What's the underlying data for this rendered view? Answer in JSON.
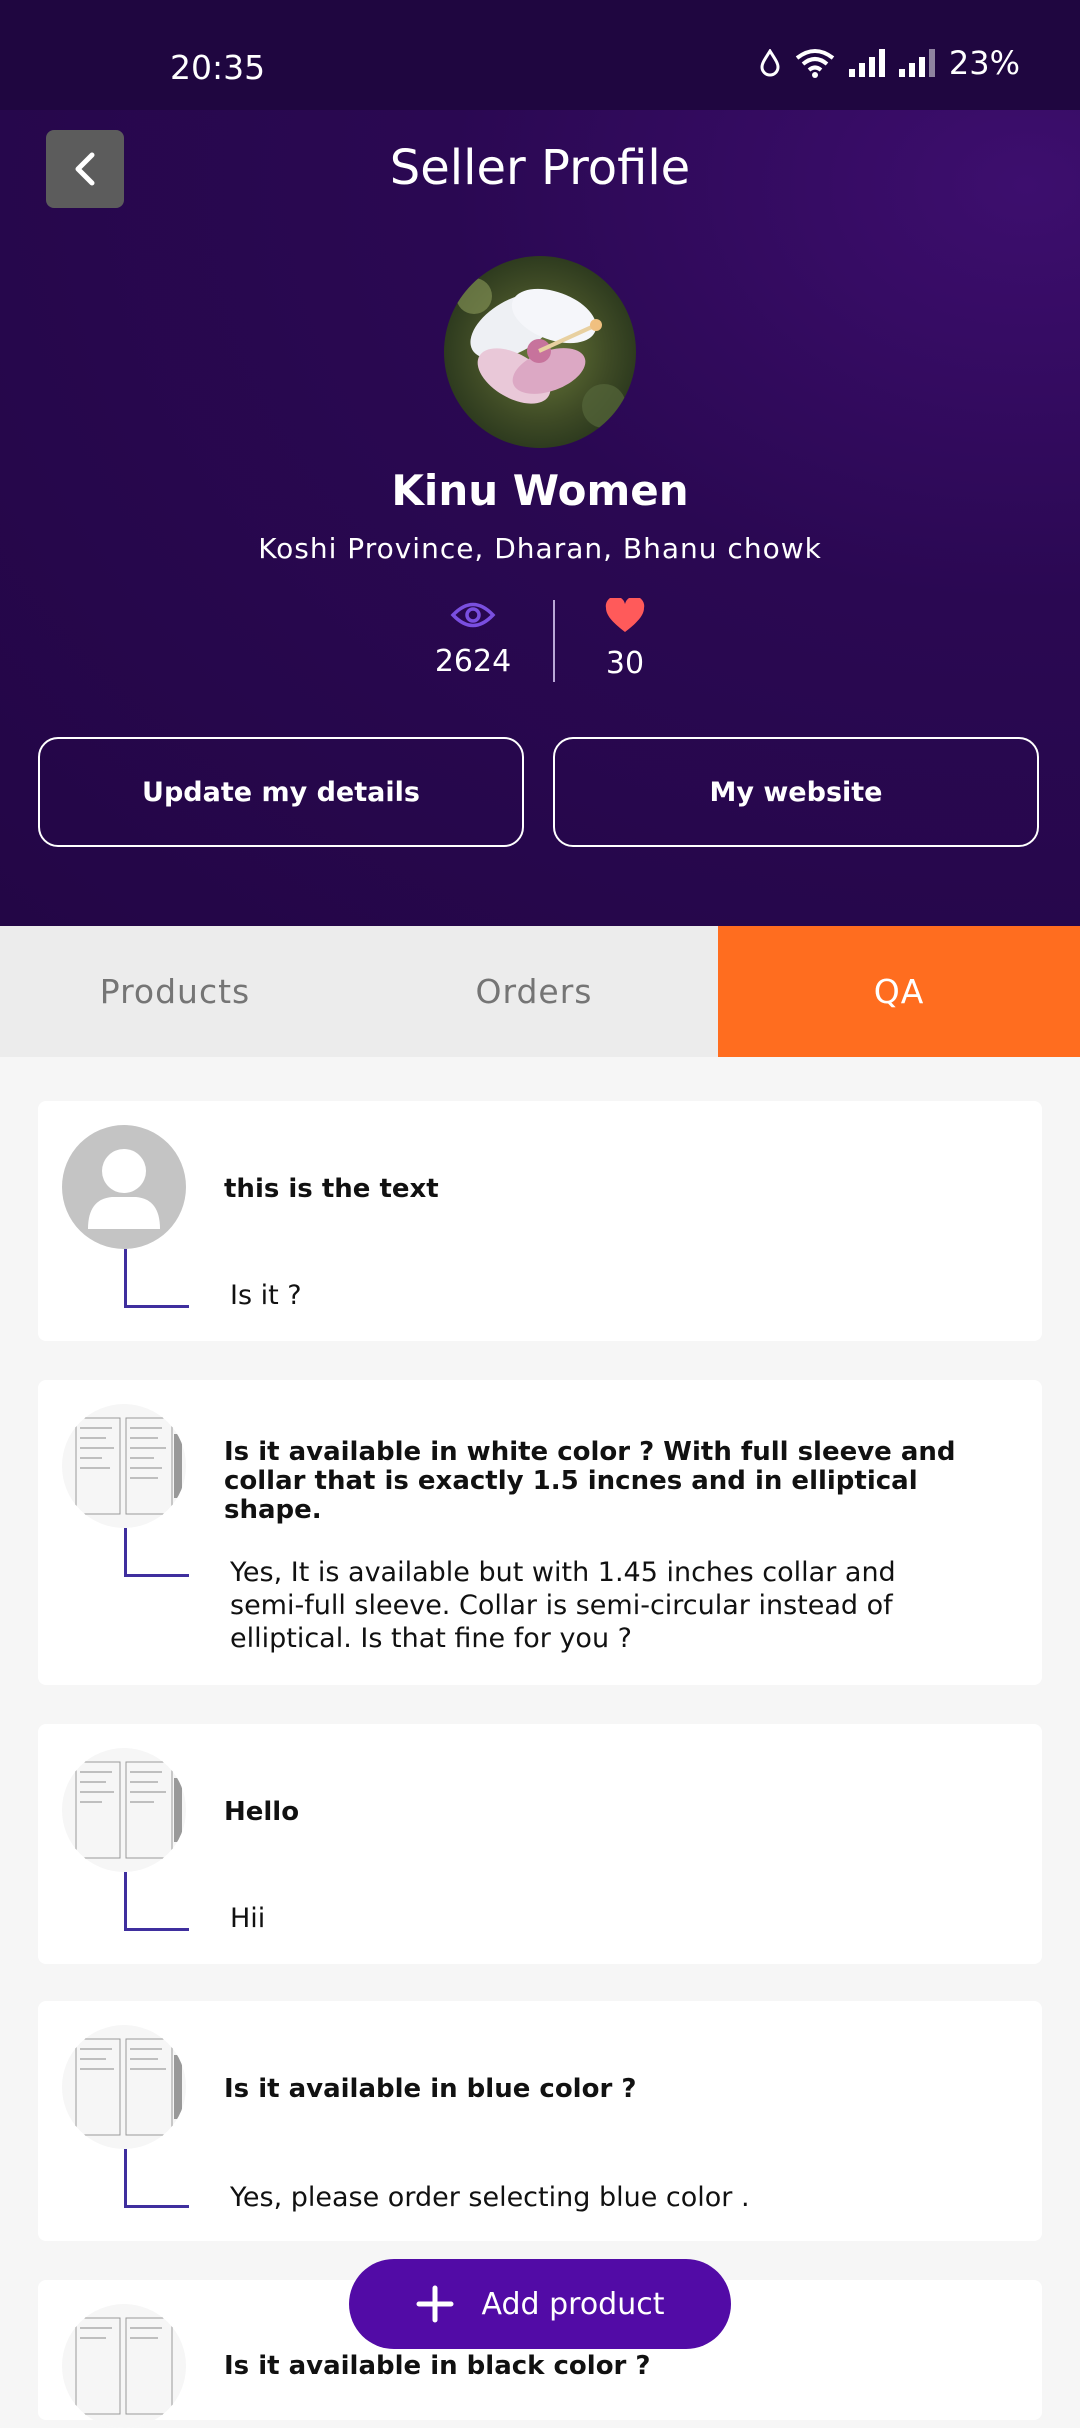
{
  "status_bar": {
    "time": "20:35",
    "battery": "23%"
  },
  "header": {
    "title": "Seller Profile"
  },
  "seller": {
    "name": "Kinu Women",
    "location": "Koshi Province, Dharan, Bhanu chowk",
    "views": "2624",
    "likes": "30"
  },
  "actions": {
    "update_label": "Update my details",
    "website_label": "My website"
  },
  "tabs": [
    {
      "label": "Products",
      "active": false
    },
    {
      "label": "Orders",
      "active": false
    },
    {
      "label": "QA",
      "active": true
    }
  ],
  "qa": [
    {
      "question": "this is the text",
      "answer": "Is it ?",
      "avatar": "person-placeholder"
    },
    {
      "question": "Is it available in white color ? With full sleeve and collar that is exactly 1.5 incnes and in elliptical shape.",
      "answer": "Yes, It is available but with 1.45 inches collar and semi-full sleeve. Collar is semi-circular instead of elliptical. Is that fine for you ?",
      "avatar": "document-thumbnail"
    },
    {
      "question": "Hello",
      "answer": "Hii",
      "avatar": "document-thumbnail"
    },
    {
      "question": "Is it available in blue color ?",
      "answer": "Yes, please order selecting blue color .",
      "avatar": "document-thumbnail"
    },
    {
      "question": "Is it available in black color ?",
      "answer": "",
      "avatar": "document-thumbnail"
    }
  ],
  "fab": {
    "label": "Add product"
  },
  "colors": {
    "header_bg": "#230646",
    "accent_orange": "#ff6d1f",
    "fab_purple": "#520ba6",
    "connector": "#3f2f9e",
    "heart": "#ff5a5a",
    "eye": "#7a4fe0"
  }
}
